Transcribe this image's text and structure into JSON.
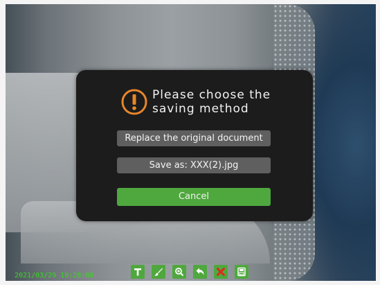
{
  "dialog": {
    "title": "Please choose the saving method",
    "replace_label": "Replace the original document",
    "saveas_label": "Save as: XXX(2).jpg",
    "cancel_label": "Cancel"
  },
  "overlay": {
    "timestamp": "2021/03/29 19:28:00"
  },
  "toolbar": {
    "icons": [
      "text-icon",
      "brush-icon",
      "zoom-icon",
      "undo-icon",
      "delete-icon",
      "save-icon"
    ]
  },
  "colors": {
    "accent_green": "#4fa83d",
    "warning_orange": "#e8862a",
    "timestamp_green": "#35d81c"
  }
}
